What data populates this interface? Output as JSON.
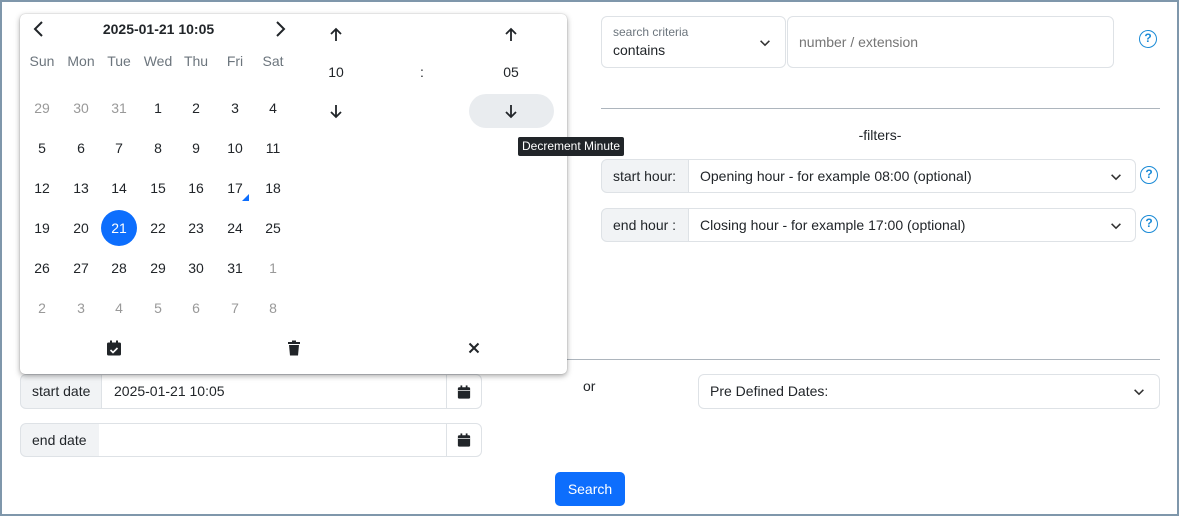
{
  "search": {
    "criteria_label": "search criteria",
    "criteria_value": "contains",
    "number_placeholder": "number / extension",
    "help_glyph": "?"
  },
  "filters": {
    "title": "-filters-",
    "start_hour_label": "start hour:",
    "start_hour_placeholder": "Opening hour - for example 08:00 (optional)",
    "end_hour_label": "end hour :",
    "end_hour_placeholder": "Closing hour - for example 17:00 (optional)"
  },
  "dates": {
    "or_label": "or",
    "predefined_placeholder": "Pre Defined Dates:",
    "start_label": "start date",
    "start_value": "2025-01-21 10:05",
    "end_label": "end date",
    "end_value": ""
  },
  "search_button": "Search",
  "picker": {
    "title": "2025-01-21 10:05",
    "weekdays": [
      "Sun",
      "Mon",
      "Tue",
      "Wed",
      "Thu",
      "Fri",
      "Sat"
    ],
    "weeks": [
      [
        "29",
        "30",
        "31",
        "1",
        "2",
        "3",
        "4"
      ],
      [
        "5",
        "6",
        "7",
        "8",
        "9",
        "10",
        "11"
      ],
      [
        "12",
        "13",
        "14",
        "15",
        "16",
        "17",
        "18"
      ],
      [
        "19",
        "20",
        "21",
        "22",
        "23",
        "24",
        "25"
      ],
      [
        "26",
        "27",
        "28",
        "29",
        "30",
        "31",
        "1"
      ],
      [
        "2",
        "3",
        "4",
        "5",
        "6",
        "7",
        "8"
      ]
    ],
    "hour": "10",
    "separator": ":",
    "minute": "05",
    "tooltip": "Decrement Minute"
  },
  "colors": {
    "accent": "#0d6efd",
    "help": "#1a8ad6",
    "frame": "#7f97ab"
  }
}
